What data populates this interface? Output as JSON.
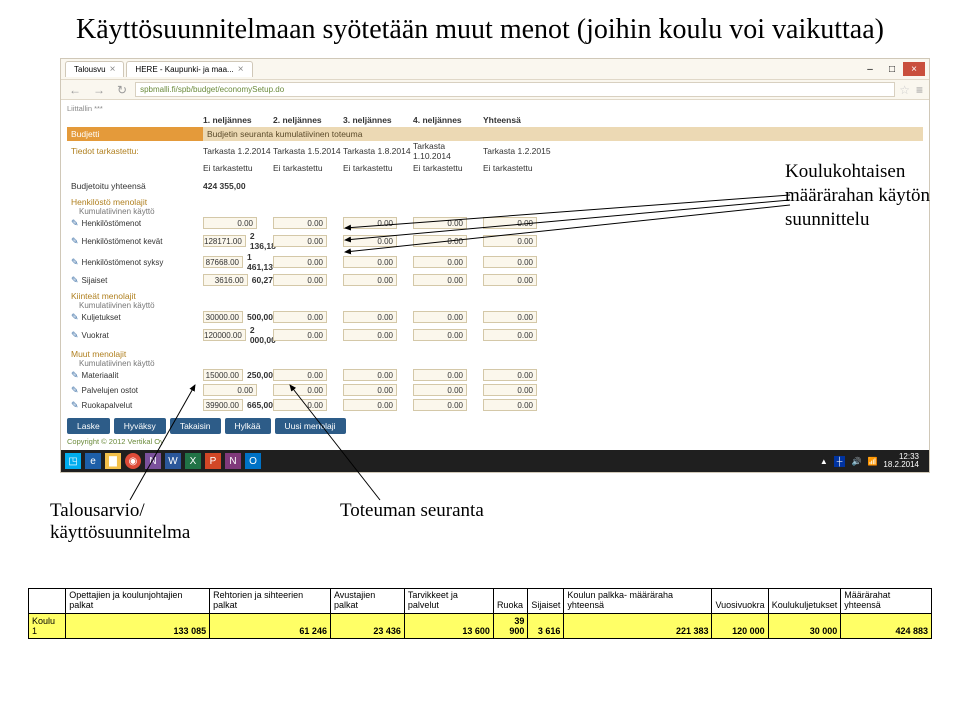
{
  "title": "Käyttösuunnitelmaan syötetään muut menot (joihin koulu voi vaikuttaa)",
  "browser": {
    "tabs": [
      {
        "label": "Talousvu"
      },
      {
        "label": "HERE - Kaupunki- ja maa..."
      }
    ],
    "url": "spbmalli.fi/spb/budget/economySetup.do",
    "win_controls": {
      "min": "–",
      "max": "□",
      "close": "×"
    }
  },
  "app": {
    "top_label": "Liittallin ***",
    "quarters": [
      "1. neljännes",
      "2. neljännes",
      "3. neljännes",
      "4. neljännes",
      "Yhteensä"
    ],
    "bar": {
      "left": "Budjetti",
      "right": "Budjetin seuranta kumulatiivinen toteuma"
    },
    "tarkast_dates": {
      "label": "Tiedot tarkastettu:",
      "cols": [
        "Tarkasta 1.2.2014",
        "Tarkasta 1.5.2014",
        "Tarkasta 1.8.2014",
        "Tarkasta 1.10.2014",
        "Tarkasta 1.2.2015"
      ],
      "vals": [
        "Ei tarkastettu",
        "Ei tarkastettu",
        "Ei tarkastettu",
        "Ei tarkastettu",
        "Ei tarkastettu"
      ]
    },
    "budj_yht_label": "Budjetoitu yhteensä",
    "budj_yht_value": "424 355,00",
    "groups": [
      {
        "heading": "Henkilöstö menolajit",
        "sub": "Kumulatiivinen käyttö",
        "rows": [
          {
            "label": "Henkilöstömenot",
            "inputs": [
              "0.00",
              "0.00",
              "0.00",
              "0.00",
              "0.00"
            ],
            "val": ""
          },
          {
            "label": "Henkilöstömenot kevät",
            "inputs": [
              "128171.00",
              "0.00",
              "0.00",
              "0.00",
              "0.00"
            ],
            "val": "2 136,18"
          },
          {
            "label": "Henkilöstömenot syksy",
            "inputs": [
              "87668.00",
              "0.00",
              "0.00",
              "0.00",
              "0.00"
            ],
            "val": "1 461,13"
          },
          {
            "label": "Sijaiset",
            "inputs": [
              "3616.00",
              "0.00",
              "0.00",
              "0.00",
              "0.00"
            ],
            "val": "60,27"
          }
        ]
      },
      {
        "heading": "Kiinteät menolajit",
        "sub": "Kumulatiivinen käyttö",
        "rows": [
          {
            "label": "Kuljetukset",
            "inputs": [
              "30000.00",
              "0.00",
              "0.00",
              "0.00",
              "0.00"
            ],
            "val": "500,00"
          },
          {
            "label": "Vuokrat",
            "inputs": [
              "120000.00",
              "0.00",
              "0.00",
              "0.00",
              "0.00"
            ],
            "val": "2 000,00"
          }
        ]
      },
      {
        "heading": "Muut menolajit",
        "sub": "Kumulatiivinen käyttö",
        "rows": [
          {
            "label": "Materiaalit",
            "inputs": [
              "15000.00",
              "0.00",
              "0.00",
              "0.00",
              "0.00"
            ],
            "val": "250,00"
          },
          {
            "label": "Palvelujen ostot",
            "inputs": [
              "0.00",
              "0.00",
              "0.00",
              "0.00",
              "0.00"
            ],
            "val": ""
          },
          {
            "label": "Ruokapalvelut",
            "inputs": [
              "39900.00",
              "0.00",
              "0.00",
              "0.00",
              "0.00"
            ],
            "val": "665,00"
          }
        ]
      }
    ],
    "buttons": [
      "Laske",
      "Hyväksy",
      "Takaisin",
      "Hylkää",
      "Uusi menolaji"
    ],
    "copyright": "Copyright © 2012 Vertikal Oy"
  },
  "taskbar": {
    "clock_time": "12:33",
    "clock_date": "18.2.2014"
  },
  "annotations": {
    "right": "Koulukohtaisen määrärahan käytön suunnittelu",
    "bottom_left": "Talousarvio/ käyttösuunnitelma",
    "bottom_right": "Toteuman seuranta"
  },
  "summary": {
    "headers": [
      "",
      "Opettajien ja koulunjohtajien palkat",
      "Rehtorien ja sihteerien palkat",
      "Avustajien palkat",
      "Tarvikkeet ja palvelut",
      "Ruoka",
      "Sijaiset",
      "Koulun palkka- määräraha yhteensä",
      "Vuosivuokra",
      "Koulukuljetukset",
      "Määrärahat yhteensä"
    ],
    "row_label": "Koulu 1",
    "values": [
      "133 085",
      "61 246",
      "23 436",
      "13 600",
      "39 900",
      "3 616",
      "221 383",
      "120 000",
      "30 000",
      "424 883"
    ]
  }
}
